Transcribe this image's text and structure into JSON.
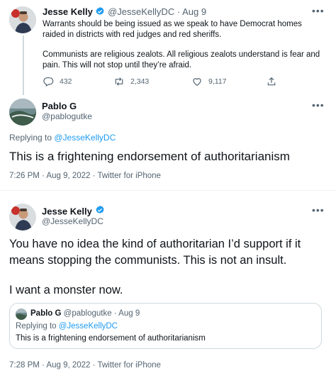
{
  "tweet1": {
    "name": "Jesse Kelly",
    "handle": "@JesseKellyDC",
    "sep": "·",
    "date": "Aug 9",
    "text_p1": "Warrants should be being issued as we speak to have Democrat homes raided in districts with red judges and red sheriffs.",
    "text_p2": "Communists are religious zealots. All religious zealots understand is fear and pain. This will not stop until they’re afraid.",
    "replies": "432",
    "retweets": "2,343",
    "likes": "9,117"
  },
  "reply": {
    "name": "Pablo G",
    "handle": "@pablogutke",
    "replying_prefix": "Replying to ",
    "replying_to": "@JesseKellyDC",
    "text": "This is a frightening endorsement of authoritarianism",
    "meta": "7:26 PM · Aug 9, 2022 · Twitter for iPhone"
  },
  "tweet2": {
    "name": "Jesse Kelly",
    "handle": "@JesseKellyDC",
    "text_p1": "You have no idea the kind of authoritarian I’d support if it means stopping the communists. This is not an insult.",
    "text_p2": "I want a monster now.",
    "meta": "7:28 PM · Aug 9, 2022 · Twitter for iPhone",
    "quote": {
      "name": "Pablo G",
      "handle_date": "@pablogutke · Aug 9",
      "replying_prefix": "Replying to ",
      "replying_to": "@JesseKellyDC",
      "text": "This is a frightening endorsement of authoritarianism"
    }
  },
  "colors": {
    "accent": "#1d9bf0",
    "muted": "#536471",
    "border": "#eff3f4"
  },
  "icons": [
    "more-icon",
    "verified-icon",
    "reply-icon",
    "retweet-icon",
    "like-icon",
    "share-icon"
  ]
}
